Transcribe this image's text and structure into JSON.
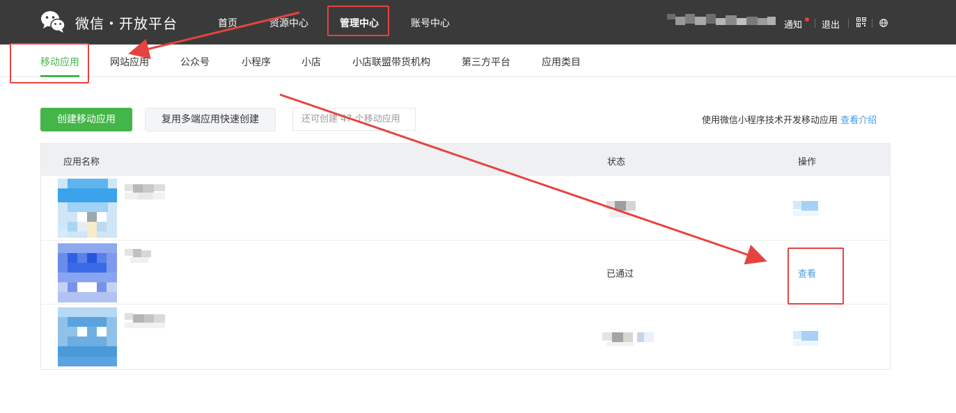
{
  "header": {
    "brand": "微信・开放平台",
    "nav": [
      "首页",
      "资源中心",
      "管理中心",
      "账号中心"
    ],
    "notice_label": "通知",
    "logout_label": "退出",
    "qr_icon": "qrcode-icon",
    "globe_icon": "globe-icon"
  },
  "subnav": {
    "tabs": [
      "移动应用",
      "网站应用",
      "公众号",
      "小程序",
      "小店",
      "小店联盟带货机构",
      "第三方平台",
      "应用类目"
    ],
    "active": "移动应用"
  },
  "toolbar": {
    "create_label": "创建移动应用",
    "reuse_label": "复用多端应用快速创建",
    "quota_text": "还可创建 47 个移动应用",
    "promo_text": "使用微信小程序技术开发移动应用",
    "promo_link": "查看介绍"
  },
  "table": {
    "headers": [
      "应用名称",
      "状态",
      "操作"
    ],
    "rows": [
      {
        "name": "",
        "status": "",
        "action": ""
      },
      {
        "name": "",
        "status": "已通过",
        "action": "查看"
      },
      {
        "name": "",
        "status": "",
        "action": ""
      }
    ]
  },
  "colors": {
    "topbar": "#3a3a3a",
    "accent_green": "#44b549",
    "link_blue": "#459ae9",
    "annotation_red": "#e64340"
  }
}
